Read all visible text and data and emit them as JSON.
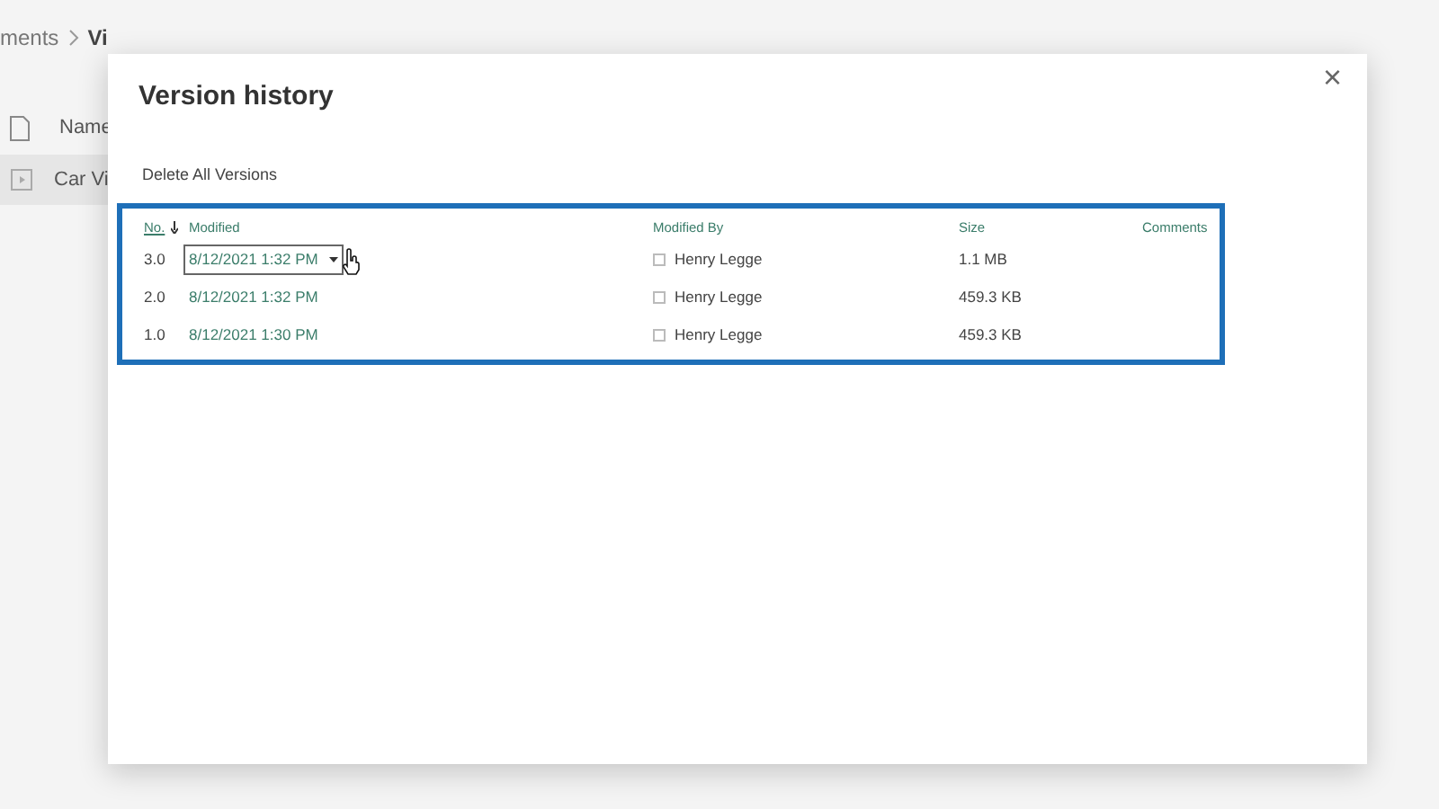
{
  "background": {
    "breadcrumb": [
      "ments",
      "Vi"
    ],
    "column_header": "Name",
    "file_name": "Car Vi"
  },
  "dialog": {
    "title": "Version history",
    "close": "×",
    "delete_all": "Delete All Versions",
    "columns": {
      "no": "No.",
      "modified": "Modified",
      "modified_by": "Modified By",
      "size": "Size",
      "comments": "Comments"
    },
    "rows": [
      {
        "no": "3.0",
        "modified": "8/12/2021 1:32 PM",
        "modified_by": "Henry Legge",
        "size": "1.1 MB",
        "selected": true
      },
      {
        "no": "2.0",
        "modified": "8/12/2021 1:32 PM",
        "modified_by": "Henry Legge",
        "size": "459.3 KB",
        "selected": false
      },
      {
        "no": "1.0",
        "modified": "8/12/2021 1:30 PM",
        "modified_by": "Henry Legge",
        "size": "459.3 KB",
        "selected": false
      }
    ]
  }
}
